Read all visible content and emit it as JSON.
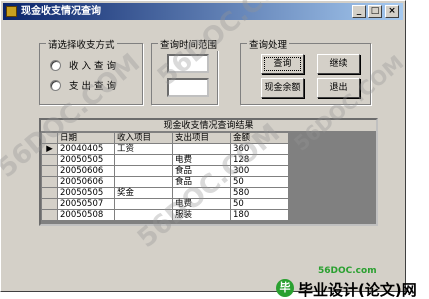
{
  "window": {
    "title": "现金收支情况查询",
    "minimize_glyph": "_",
    "maximize_glyph": "□",
    "close_glyph": "×"
  },
  "payment_mode": {
    "label": "请选择收支方式",
    "options": [
      "收入查询",
      "支出查询"
    ]
  },
  "query_time": {
    "label": "查询时间范围"
  },
  "query_actions": {
    "label": "查询处理",
    "buttons": [
      "查询",
      "继续",
      "现金余额",
      "退出"
    ]
  },
  "results": {
    "caption": "现金收支情况查询结果",
    "columns": [
      "日期",
      "收入项目",
      "支出项目",
      "金额"
    ],
    "current_row_marker": "▶",
    "rows": [
      [
        "20040405",
        "工资",
        "",
        "360"
      ],
      [
        "20050505",
        "",
        "电费",
        "128"
      ],
      [
        "20050606",
        "",
        "食品",
        "300"
      ],
      [
        "20050606",
        "",
        "食品",
        "50"
      ],
      [
        "20050505",
        "奖金",
        "",
        "580"
      ],
      [
        "20050507",
        "",
        "电费",
        "50"
      ],
      [
        "20050508",
        "",
        "服装",
        "180"
      ]
    ]
  },
  "watermark": {
    "text": "56DOC.COM"
  },
  "site_footer": {
    "domain": "56DOC.com",
    "logo_glyph": "毕",
    "title": "毕业设计(论文)网"
  }
}
